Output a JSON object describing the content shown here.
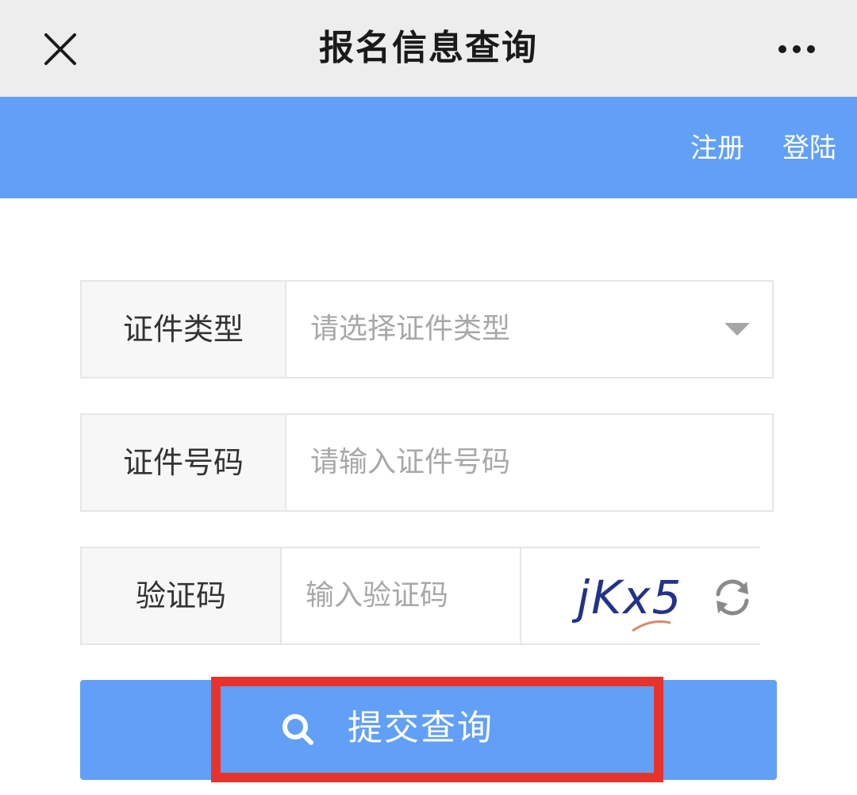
{
  "header": {
    "title": "报名信息查询",
    "close_icon": "close-icon",
    "more_icon": "more-dots-icon"
  },
  "nav": {
    "register_label": "注册",
    "login_label": "登陆",
    "bar_color": "#62a0f7"
  },
  "form": {
    "id_type": {
      "label": "证件类型",
      "placeholder": "请选择证件类型",
      "icon": "dropdown-arrow-icon"
    },
    "id_number": {
      "label": "证件号码",
      "placeholder": "请输入证件号码"
    },
    "captcha": {
      "label": "验证码",
      "placeholder": "输入验证码",
      "image_text": "jKx5",
      "refresh_icon": "refresh-icon"
    }
  },
  "submit": {
    "label": "提交查询",
    "icon": "search-icon",
    "highlight_color": "#e8332c"
  }
}
